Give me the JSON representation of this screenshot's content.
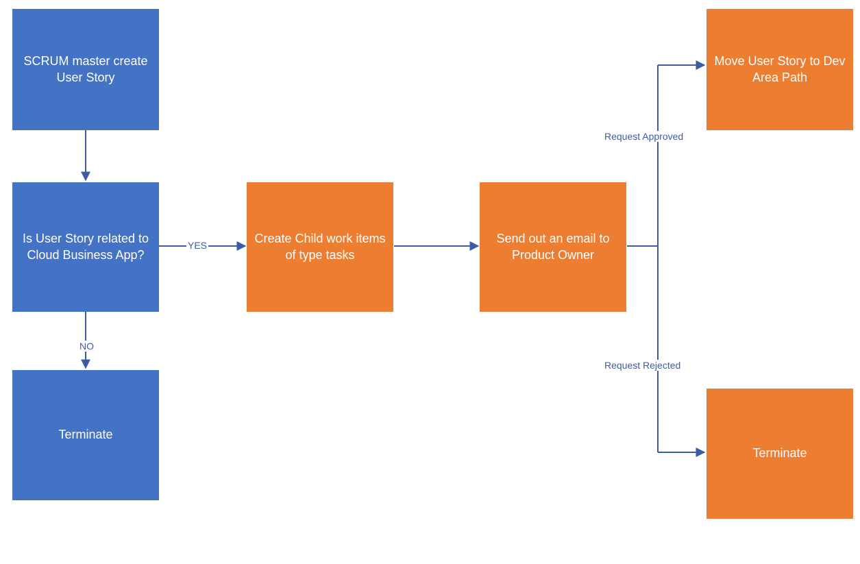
{
  "nodes": {
    "scrum_master": {
      "label": "SCRUM master create User Story"
    },
    "decision": {
      "label": "Is User Story related to Cloud Business App?"
    },
    "terminate1": {
      "label": "Terminate"
    },
    "create_child": {
      "label": "Create Child work items of type tasks"
    },
    "send_email": {
      "label": "Send out an email to Product Owner"
    },
    "move_story": {
      "label": "Move User Story to Dev Area Path"
    },
    "terminate2": {
      "label": "Terminate"
    }
  },
  "edges": {
    "yes": "YES",
    "no": "NO",
    "approved": "Request Approved",
    "rejected": "Request Rejected"
  },
  "colors": {
    "blue": "#4472C4",
    "orange": "#ED7D31",
    "connector": "#3B5BA5"
  }
}
